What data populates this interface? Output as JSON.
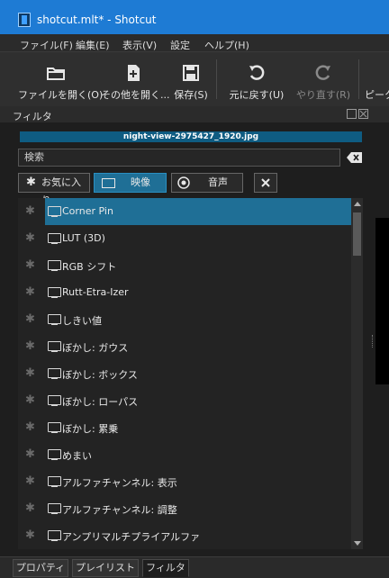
{
  "window": {
    "title": "shotcut.mlt* - Shotcut"
  },
  "menu": [
    "ファイル(F)",
    "編集(E)",
    "表示(V)",
    "設定",
    "ヘルプ(H)"
  ],
  "toolbar": {
    "open": "ファイルを開く(O)",
    "open_other": "その他を開く...",
    "save": "保存(S)",
    "undo": "元に戻す(U)",
    "redo": "やり直す(R)",
    "peak": "ピーク"
  },
  "panel": {
    "title": "フィルタ"
  },
  "clip": {
    "name": "night-view-2975427_1920.jpg"
  },
  "search": {
    "placeholder": "検索"
  },
  "filter_tabs": {
    "favorites": "お気に入り",
    "video": "映像",
    "audio": "音声"
  },
  "filters": [
    "Corner Pin",
    "LUT (3D)",
    "RGB シフト",
    "Rutt-Etra-Izer",
    "しきい値",
    "ぼかし: ガウス",
    "ぼかし: ボックス",
    "ぼかし: ローパス",
    "ぼかし: 累乗",
    "めまい",
    "アルファチャンネル: 表示",
    "アルファチャンネル: 調整",
    "アンプリマルチプライアルファ"
  ],
  "bottom_tabs": [
    "プロパティ",
    "プレイリスト",
    "フィルタ"
  ],
  "colors": {
    "accent": "#1f6f96",
    "titlebar": "#1e7bd4"
  }
}
